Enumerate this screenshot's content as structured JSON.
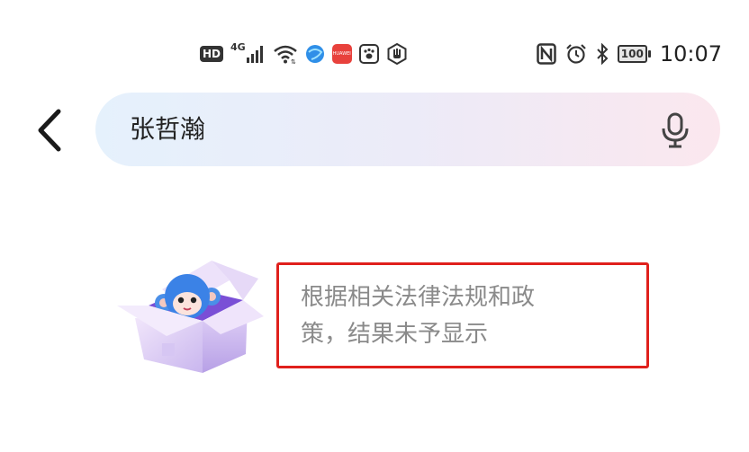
{
  "status_bar": {
    "hd_label": "HD",
    "network_label": "4G",
    "app_icons": [
      "globe-app-icon",
      "huawei-store-icon",
      "paw-app-icon",
      "hand-app-icon"
    ],
    "huawei_label": "HUAWEI",
    "battery_level": "100",
    "time": "10:07"
  },
  "header": {
    "back_icon": "chevron-left-icon",
    "search_query": "张哲瀚",
    "mic_icon": "microphone-icon"
  },
  "notice": {
    "line1": "根据相关法律法规和政",
    "line2": "策，结果未予显示",
    "highlight_color": "#e0201c"
  }
}
